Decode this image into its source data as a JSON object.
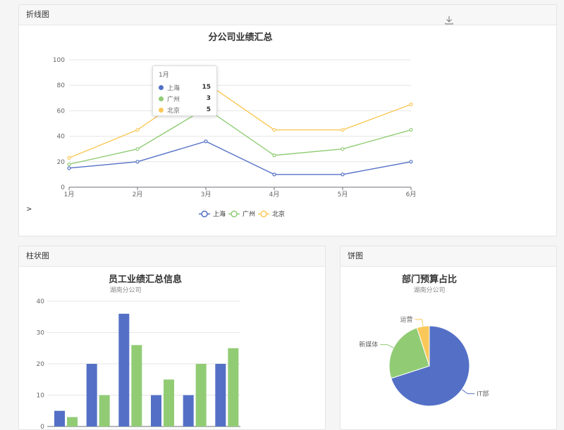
{
  "colors": {
    "blue": "#5470c6",
    "green": "#91cc75",
    "yellow": "#fac858",
    "grid": "#e6e6e6",
    "axis": "#6e7079"
  },
  "line_panel": {
    "header": "折线图",
    "caret": ">",
    "tooltip": {
      "title": "1月",
      "rows": [
        {
          "name": "上海",
          "value": "15",
          "color": "#5470c6"
        },
        {
          "name": "广州",
          "value": "3",
          "color": "#91cc75"
        },
        {
          "name": "北京",
          "value": "5",
          "color": "#fac858"
        }
      ]
    }
  },
  "bar_panel": {
    "header": "柱状图"
  },
  "pie_panel": {
    "header": "饼图"
  },
  "chart_data": [
    {
      "type": "line",
      "title": "分公司业绩汇总",
      "categories": [
        "1月",
        "2月",
        "3月",
        "4月",
        "5月",
        "6月"
      ],
      "ylim": [
        0,
        100
      ],
      "yticks": [
        0,
        20,
        40,
        60,
        80,
        100
      ],
      "series": [
        {
          "name": "上海",
          "color": "#5470c6",
          "values": [
            15,
            20,
            36,
            10,
            10,
            20
          ]
        },
        {
          "name": "广州",
          "color": "#91cc75",
          "values": [
            18,
            30,
            62,
            25,
            30,
            45
          ]
        },
        {
          "name": "北京",
          "color": "#fac858",
          "values": [
            23,
            45,
            82,
            45,
            45,
            65
          ]
        }
      ],
      "legend": "bottom-center",
      "grid": true
    },
    {
      "type": "bar",
      "title": "员工业绩汇总信息",
      "subtitle": "湖南分公司",
      "ylim": [
        0,
        40
      ],
      "yticks": [
        0,
        10,
        20,
        30,
        40
      ],
      "series": [
        {
          "color": "#5470c6",
          "values": [
            5,
            20,
            36,
            10,
            10,
            20
          ]
        },
        {
          "color": "#91cc75",
          "values": [
            3,
            10,
            26,
            15,
            20,
            25
          ]
        }
      ],
      "grid": true
    },
    {
      "type": "pie",
      "title": "部门预算占比",
      "subtitle": "湖南分公司",
      "slices": [
        {
          "name": "IT部",
          "value": 70,
          "color": "#5470c6"
        },
        {
          "name": "新媒体",
          "value": 25,
          "color": "#91cc75"
        },
        {
          "name": "运营",
          "value": 5,
          "color": "#fac858"
        }
      ]
    }
  ]
}
